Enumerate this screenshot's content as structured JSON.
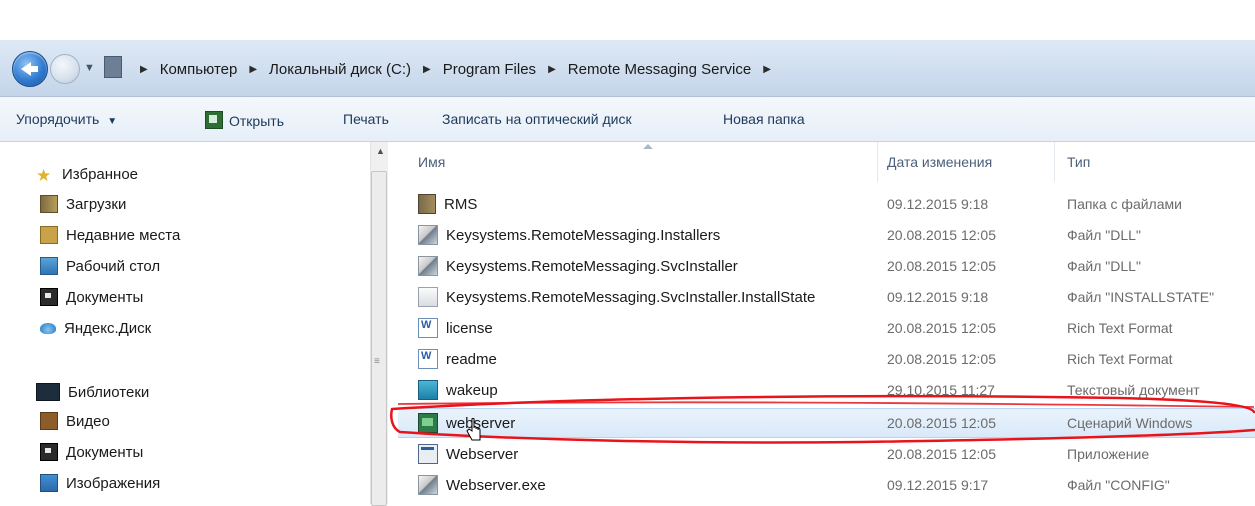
{
  "breadcrumb": [
    "Компьютер",
    "Локальный диск (C:)",
    "Program Files",
    "Remote Messaging Service"
  ],
  "toolbar": {
    "organize": "Упорядочить",
    "open": "Открыть",
    "print": "Печать",
    "burn": "Записать на оптический диск",
    "new_folder": "Новая папка"
  },
  "sidebar": {
    "favorites_title": "Избранное",
    "favorites": [
      "Загрузки",
      "Недавние места",
      "Рабочий стол",
      "Документы",
      "Яндекс.Диск"
    ],
    "libraries_title": "Библиотеки",
    "libraries": [
      "Видео",
      "Документы",
      "Изображения"
    ]
  },
  "columns": {
    "name": "Имя",
    "date": "Дата изменения",
    "type": "Тип"
  },
  "files": [
    {
      "name": "RMS",
      "date": "09.12.2015 9:18",
      "type": "Папка с файлами",
      "icon": "folder-icon"
    },
    {
      "name": "Keysystems.RemoteMessaging.Installers",
      "date": "20.08.2015 12:05",
      "type": "Файл \"DLL\"",
      "icon": "dll-file-icon"
    },
    {
      "name": "Keysystems.RemoteMessaging.SvcInstaller",
      "date": "20.08.2015 12:05",
      "type": "Файл \"DLL\"",
      "icon": "dll-file-icon"
    },
    {
      "name": "Keysystems.RemoteMessaging.SvcInstaller.InstallState",
      "date": "09.12.2015 9:18",
      "type": "Файл \"INSTALLSTATE\"",
      "icon": "installstate-file-icon"
    },
    {
      "name": "license",
      "date": "20.08.2015 12:05",
      "type": "Rich Text Format",
      "icon": "rtf-file-icon"
    },
    {
      "name": "readme",
      "date": "20.08.2015 12:05",
      "type": "Rich Text Format",
      "icon": "rtf-file-icon"
    },
    {
      "name": "wakeup",
      "date": "29.10.2015 11:27",
      "type": "Текстовый документ",
      "icon": "text-file-icon"
    },
    {
      "name": "webserver",
      "date": "20.08.2015 12:05",
      "type": "Сценарий Windows",
      "icon": "windows-script-icon"
    },
    {
      "name": "Webserver",
      "date": "20.08.2015 12:05",
      "type": "Приложение",
      "icon": "application-icon"
    },
    {
      "name": "Webserver.exe",
      "date": "09.12.2015 9:17",
      "type": "Файл \"CONFIG\"",
      "icon": "config-file-icon"
    }
  ],
  "colors": {
    "annotation": "#e8141c",
    "selection": "#d9e9f9",
    "toolbar_text": "#1e395b"
  }
}
